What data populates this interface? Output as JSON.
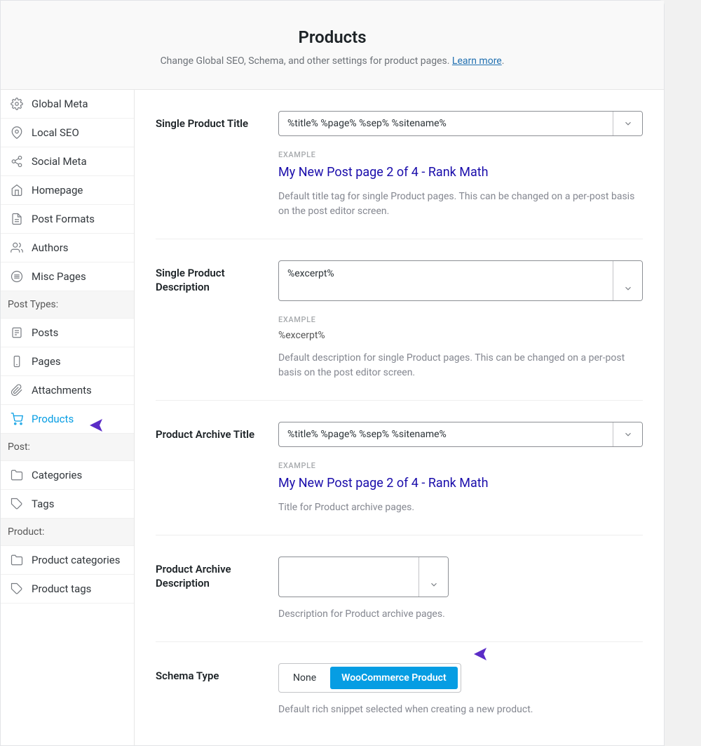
{
  "header": {
    "title": "Products",
    "subtitle_prefix": "Change Global SEO, Schema, and other settings for product pages. ",
    "learn_more": "Learn more"
  },
  "sidebar": {
    "general": [
      {
        "label": "Global Meta"
      },
      {
        "label": "Local SEO"
      },
      {
        "label": "Social Meta"
      },
      {
        "label": "Homepage"
      },
      {
        "label": "Post Formats"
      },
      {
        "label": "Authors"
      },
      {
        "label": "Misc Pages"
      }
    ],
    "post_types_header": "Post Types:",
    "post_types": [
      {
        "label": "Posts"
      },
      {
        "label": "Pages"
      },
      {
        "label": "Attachments"
      },
      {
        "label": "Products"
      }
    ],
    "post_header": "Post:",
    "post": [
      {
        "label": "Categories"
      },
      {
        "label": "Tags"
      }
    ],
    "product_header": "Product:",
    "product": [
      {
        "label": "Product categories"
      },
      {
        "label": "Product tags"
      }
    ]
  },
  "fields": {
    "single_title": {
      "label": "Single Product Title",
      "value": "%title% %page% %sep% %sitename%",
      "example_label": "EXAMPLE",
      "example_value": "My New Post page 2 of 4 - Rank Math",
      "help": "Default title tag for single Product pages. This can be changed on a per-post basis on the post editor screen."
    },
    "single_desc": {
      "label": "Single Product Description",
      "value": "%excerpt%",
      "example_label": "EXAMPLE",
      "example_value": "%excerpt%",
      "help": "Default description for single Product pages. This can be changed on a per-post basis on the post editor screen."
    },
    "archive_title": {
      "label": "Product Archive Title",
      "value": "%title% %page% %sep% %sitename%",
      "example_label": "EXAMPLE",
      "example_value": "My New Post page 2 of 4 - Rank Math",
      "help": "Title for Product archive pages."
    },
    "archive_desc": {
      "label": "Product Archive Description",
      "value": "",
      "help": "Description for Product archive pages."
    },
    "schema": {
      "label": "Schema Type",
      "option_none": "None",
      "option_wc": "WooCommerce Product",
      "help": "Default rich snippet selected when creating a new product."
    }
  }
}
